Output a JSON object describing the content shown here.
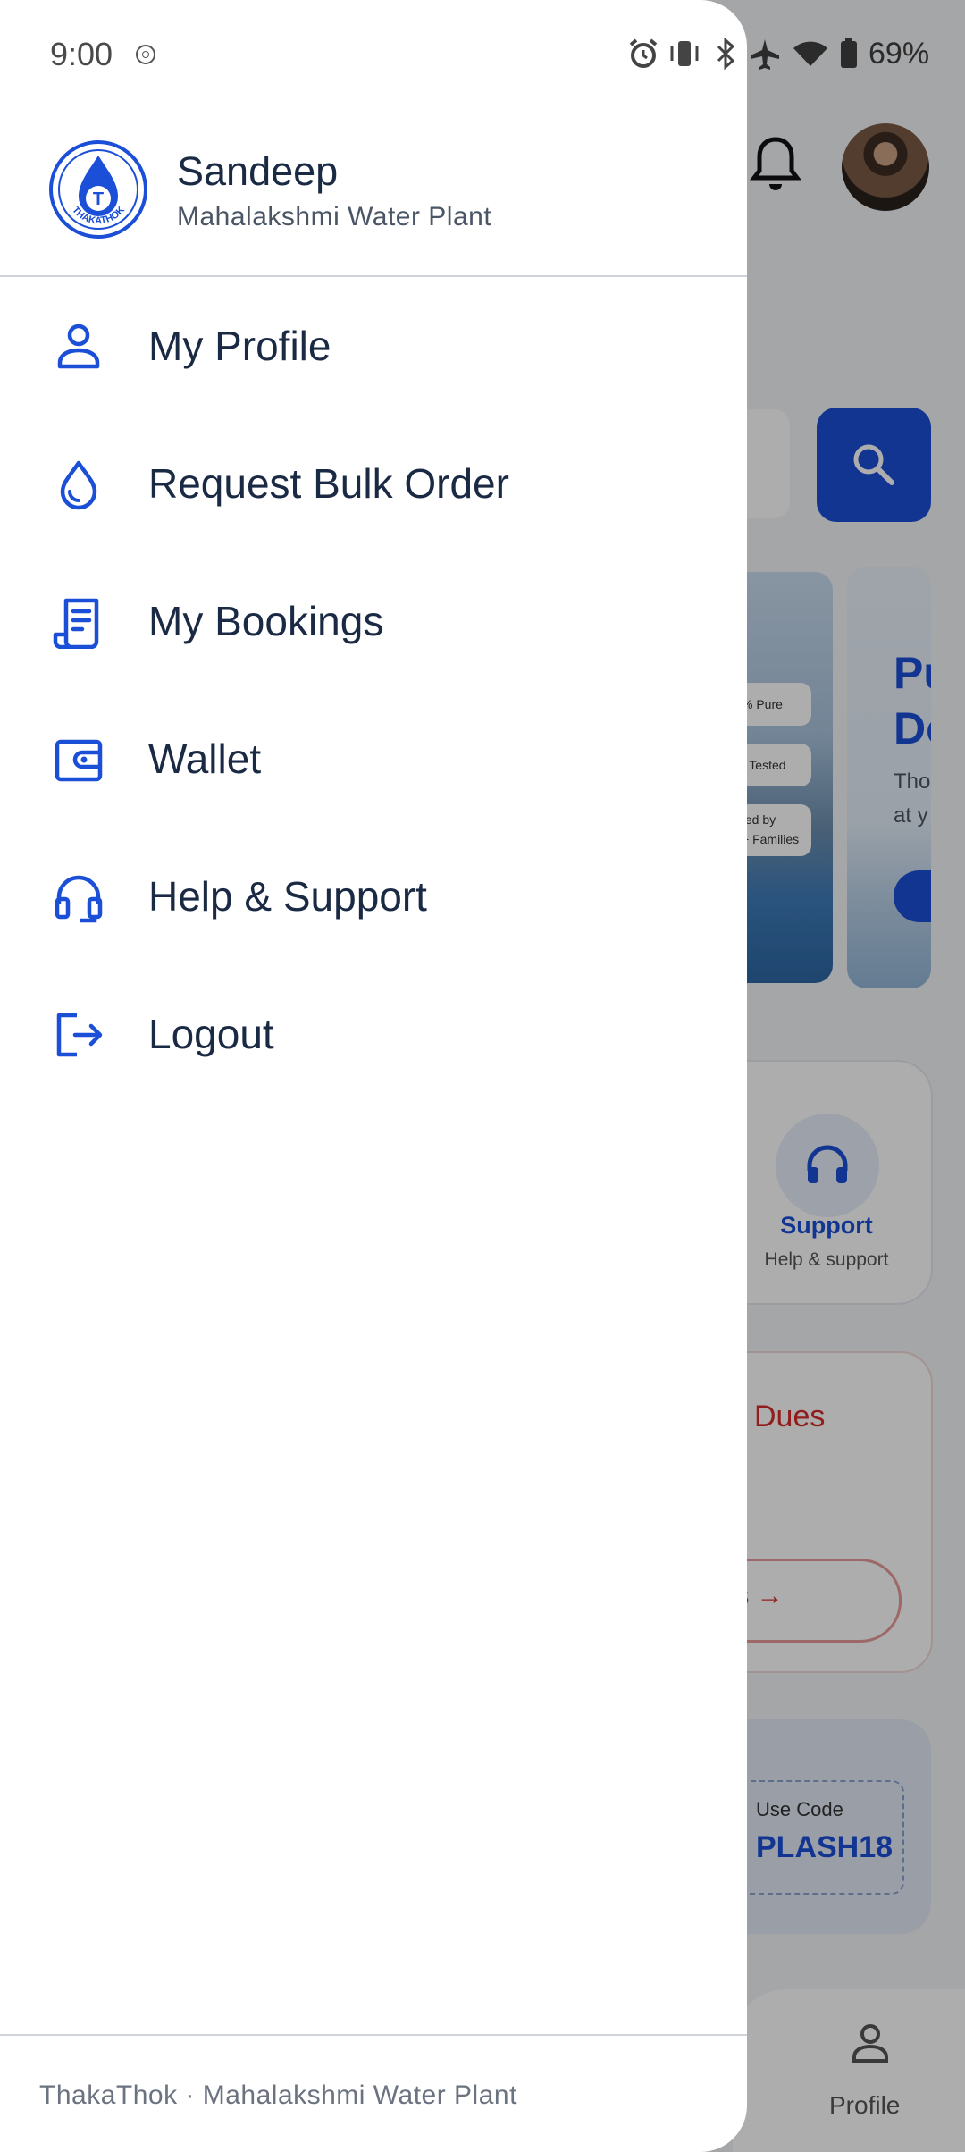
{
  "status_bar": {
    "time": "9:00",
    "battery": "69%"
  },
  "user": {
    "name": "Sandeep",
    "plant": "Mahalakshmi Water Plant",
    "logo_text": "THAKATHOK"
  },
  "menu": [
    {
      "label": "My Profile",
      "icon": "person-icon"
    },
    {
      "label": "Request Bulk Order",
      "icon": "water-drop-icon"
    },
    {
      "label": "My Bookings",
      "icon": "receipt-icon"
    },
    {
      "label": "Wallet",
      "icon": "wallet-icon"
    },
    {
      "label": "Help & Support",
      "icon": "headset-icon"
    },
    {
      "label": "Logout",
      "icon": "logout-icon"
    }
  ],
  "footer": {
    "text": "ThakaThok · Mahalakshmi Water Plant"
  },
  "background": {
    "support_title": "Support",
    "support_subtitle": "Help & support",
    "dues_title": "Dues",
    "dues_button": "ils →",
    "promo_label": "Use Code",
    "promo_code": "PLASH18",
    "nav_profile": "Profile",
    "banner_big": "Pu\nDo",
    "banner_small": "Tho\nat y",
    "chips": [
      "% Pure",
      "- Tested",
      "ted by\n+ Families"
    ]
  },
  "colors": {
    "accent": "#1b4fd8",
    "text_dark": "#1b2a44",
    "danger": "#d62b2b"
  }
}
